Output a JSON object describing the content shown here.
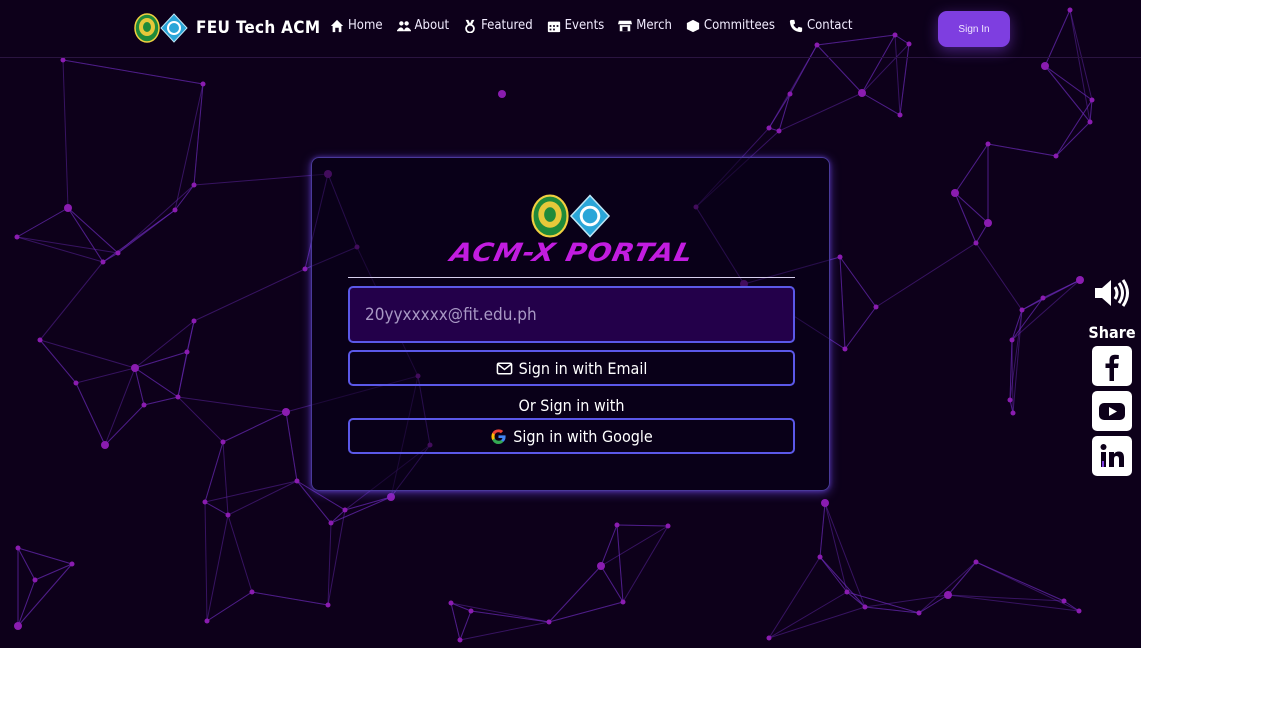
{
  "brand": {
    "title": "FEU Tech ACM"
  },
  "nav": {
    "items": [
      {
        "label": "Home",
        "icon": "home-icon"
      },
      {
        "label": "About",
        "icon": "users-icon"
      },
      {
        "label": "Featured",
        "icon": "medal-icon"
      },
      {
        "label": "Events",
        "icon": "calendar-icon"
      },
      {
        "label": "Merch",
        "icon": "store-icon"
      },
      {
        "label": "Committees",
        "icon": "cube-icon"
      },
      {
        "label": "Contact",
        "icon": "phone-icon"
      }
    ],
    "signin_label": "Sign In"
  },
  "card": {
    "title": "ACM-X PORTAL",
    "email_placeholder": "20yyxxxxx@fit.edu.ph",
    "email_button_label": "Sign in with Email",
    "or_text": "Or Sign in with",
    "google_button_label": "Sign in with Google"
  },
  "side": {
    "share_label": "Share",
    "socials": [
      "facebook-icon",
      "youtube-icon",
      "linkedin-icon"
    ]
  },
  "colors": {
    "background": "#0d001a",
    "accent": "#7e3ee0",
    "portal_title": "#c21ce0",
    "input_bg": "#23004a",
    "button_border": "#5b58e8"
  }
}
